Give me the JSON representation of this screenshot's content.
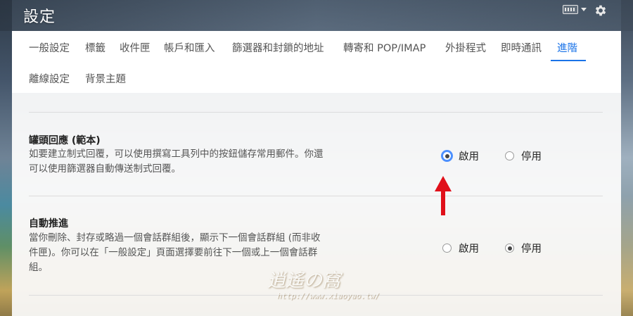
{
  "app": {
    "title": "設定"
  },
  "tabs": [
    {
      "label": "一般設定"
    },
    {
      "label": "標籤"
    },
    {
      "label": "收件匣"
    },
    {
      "label": "帳戶和匯入"
    },
    {
      "label": "篩選器和封鎖的地址"
    },
    {
      "label": "轉寄和 POP/IMAP"
    },
    {
      "label": "外掛程式"
    },
    {
      "label": "即時通訊"
    },
    {
      "label": "進階"
    },
    {
      "label": "離線設定"
    },
    {
      "label": "背景主題"
    }
  ],
  "active_tab": "進階",
  "settings": [
    {
      "title": "罐頭回應 (範本)",
      "description_line1": "如要建立制式回覆，可以使用撰寫工具列中的按鈕儲存常用郵件。你還",
      "description_line2": "可以使用篩選器自動傳送制式回覆。",
      "options": [
        {
          "label": "啟用",
          "checked": true
        },
        {
          "label": "停用",
          "checked": false
        }
      ]
    },
    {
      "title": "自動推進",
      "description_line1": "當你刪除、封存或略過一個會話群組後，顯示下一個會話群組 (而非收",
      "description_line2": "件匣)。你可以在「一般設定」頁面選擇要前往下一個或上一個會話群",
      "description_line3": "組。",
      "options": [
        {
          "label": "啟用",
          "checked": false
        },
        {
          "label": "停用",
          "checked": true
        }
      ]
    }
  ],
  "watermark": {
    "text": "逍遙の窩",
    "url": "http://www.xiaoyao.tw/"
  },
  "colors": {
    "accent": "#1a73e8",
    "arrow": "#e0101a"
  }
}
